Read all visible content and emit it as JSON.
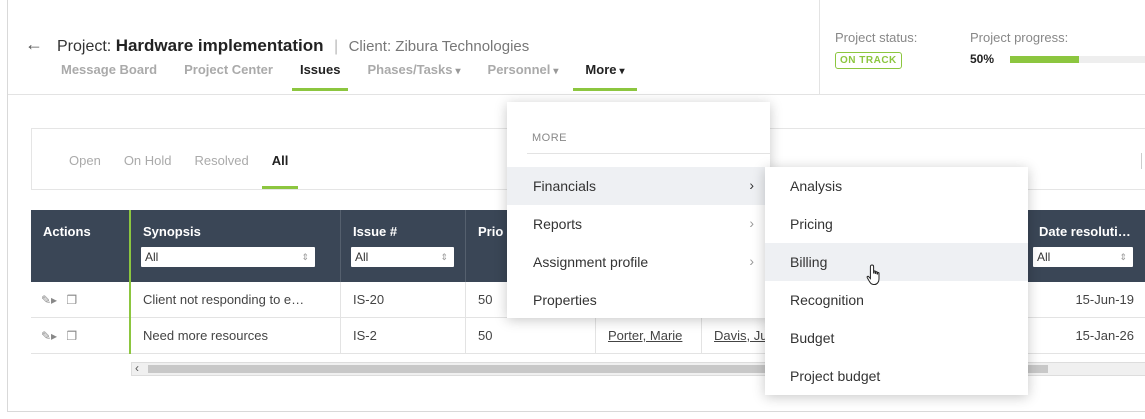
{
  "header": {
    "project_prefix": "Project:",
    "project_name": "Hardware implementation",
    "separator": "|",
    "client": "Client: Zibura Technologies",
    "tabs": [
      {
        "label": "Message Board"
      },
      {
        "label": "Project Center"
      },
      {
        "label": "Issues"
      },
      {
        "label": "Phases/Tasks"
      },
      {
        "label": "Personnel"
      },
      {
        "label": "More"
      }
    ],
    "status_label": "Project status:",
    "status_value": "ON TRACK",
    "progress_label": "Project progress:",
    "progress_value": "50%",
    "progress_fraction": 0.5
  },
  "filters": {
    "tabs": [
      {
        "label": "Open"
      },
      {
        "label": "On Hold"
      },
      {
        "label": "Resolved"
      },
      {
        "label": "All"
      }
    ]
  },
  "table": {
    "columns": [
      {
        "label": "Actions"
      },
      {
        "label": "Synopsis",
        "filter": "All"
      },
      {
        "label": "Issue #",
        "filter": "All"
      },
      {
        "label": "Prio"
      },
      {
        "label": "Date resoluti…",
        "filter": "All"
      }
    ],
    "rows": [
      {
        "synopsis": "Client not responding to e…",
        "issue": "IS-20",
        "priority": "50",
        "date": "15-Jun-19"
      },
      {
        "synopsis": "Need more resources",
        "issue": "IS-2",
        "priority": "50",
        "person1": "Porter, Marie",
        "person2": "Davis, Ju",
        "date": "15-Jan-26"
      }
    ]
  },
  "more_menu": {
    "header": "MORE",
    "items": [
      {
        "label": "Financials",
        "chevron": "›"
      },
      {
        "label": "Reports",
        "chevron": "›"
      },
      {
        "label": "Assignment profile",
        "chevron": "›"
      },
      {
        "label": "Properties"
      }
    ]
  },
  "financials_menu": {
    "items": [
      {
        "label": "Analysis"
      },
      {
        "label": "Pricing"
      },
      {
        "label": "Billing"
      },
      {
        "label": "Recognition"
      },
      {
        "label": "Budget"
      },
      {
        "label": "Project budget"
      }
    ]
  },
  "colors": {
    "accent": "#8cc63f",
    "table_header": "#3a4656",
    "highlight": "#eef0f3"
  }
}
